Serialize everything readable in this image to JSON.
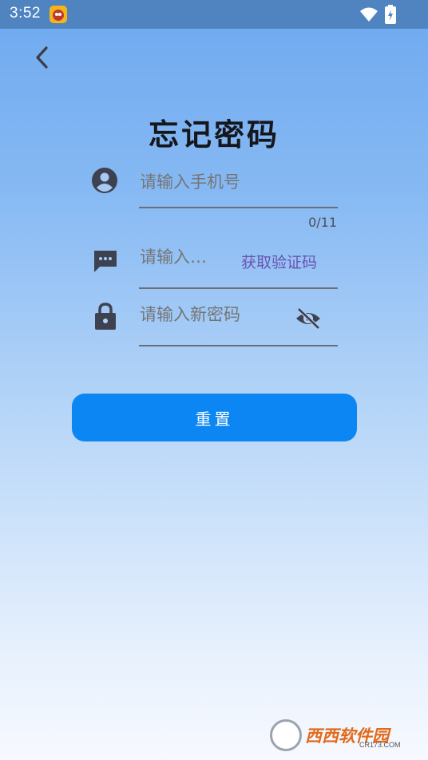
{
  "status_bar": {
    "time": "3:52"
  },
  "header": {
    "title": "忘记密码"
  },
  "phone_field": {
    "placeholder": "请输入手机号",
    "counter": "0/11"
  },
  "code_field": {
    "placeholder": "请输入…",
    "get_code_label": "获取验证码"
  },
  "password_field": {
    "placeholder": "请输入新密码"
  },
  "reset_button": {
    "label": "重置"
  },
  "watermark": {
    "brand": "西西软件园",
    "sub": "CR173.COM"
  },
  "colors": {
    "status_bar": "#4f84c1",
    "primary_button": "#0b86f2",
    "link": "#6a52b0",
    "icon": "#3e4250"
  },
  "icons": [
    "back-arrow",
    "account-circle",
    "sms-dots",
    "lock",
    "eye-off",
    "wifi",
    "battery-charging"
  ]
}
